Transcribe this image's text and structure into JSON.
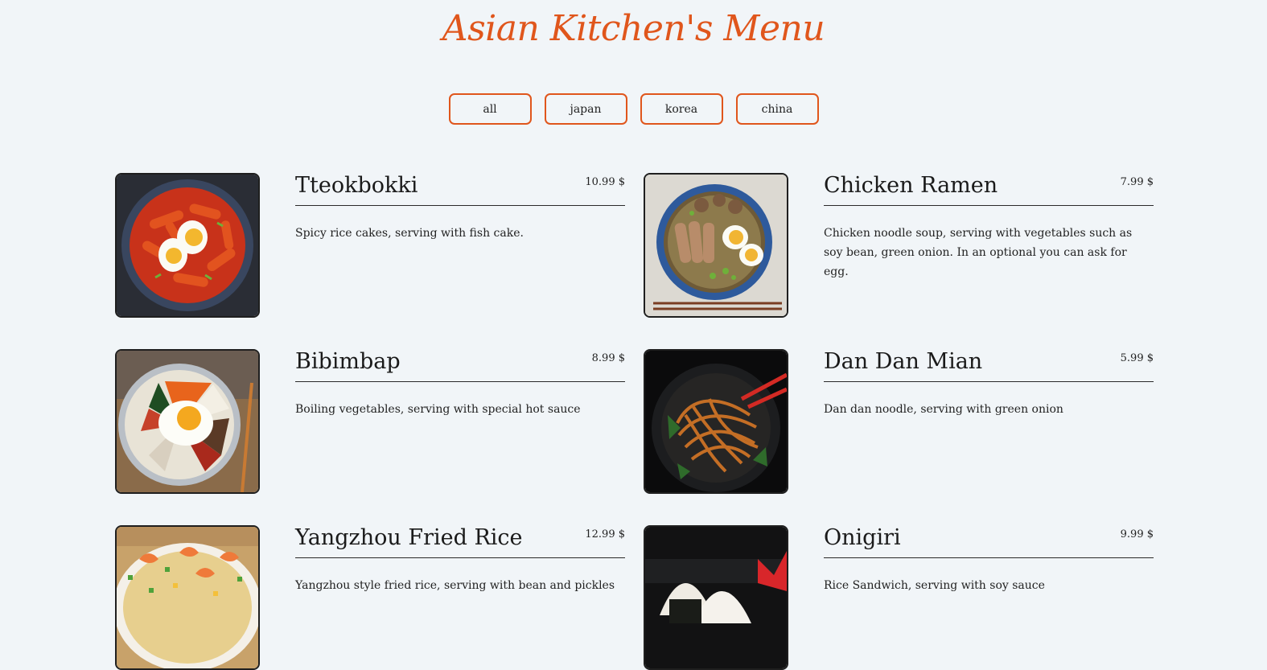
{
  "header": {
    "title": "Asian Kitchen's Menu"
  },
  "filters": [
    "all",
    "japan",
    "korea",
    "china"
  ],
  "menu": [
    {
      "name": "Tteokbokki",
      "price": "10.99 $",
      "desc": "Spicy rice cakes, serving with fish cake.",
      "image": "tteokbokki-photo"
    },
    {
      "name": "Chicken Ramen",
      "price": "7.99 $",
      "desc": "Chicken noodle soup, serving with vegetables such as soy bean, green onion. In an optional you can ask for egg.",
      "image": "chicken-ramen-photo"
    },
    {
      "name": "Bibimbap",
      "price": "8.99 $",
      "desc": "Boiling vegetables, serving with special hot sauce",
      "image": "bibimbap-photo"
    },
    {
      "name": "Dan Dan Mian",
      "price": "5.99 $",
      "desc": "Dan dan noodle, serving with green onion",
      "image": "dan-dan-mian-photo"
    },
    {
      "name": "Yangzhou Fried Rice",
      "price": "12.99 $",
      "desc": "Yangzhou style fried rice, serving with bean and pickles",
      "image": "yangzhou-fried-rice-photo"
    },
    {
      "name": "Onigiri",
      "price": "9.99 $",
      "desc": "Rice Sandwich, serving with soy sauce",
      "image": "onigiri-photo"
    }
  ],
  "colors": {
    "accent": "#e0561c",
    "background": "#f1f5f8",
    "text": "#222222"
  }
}
